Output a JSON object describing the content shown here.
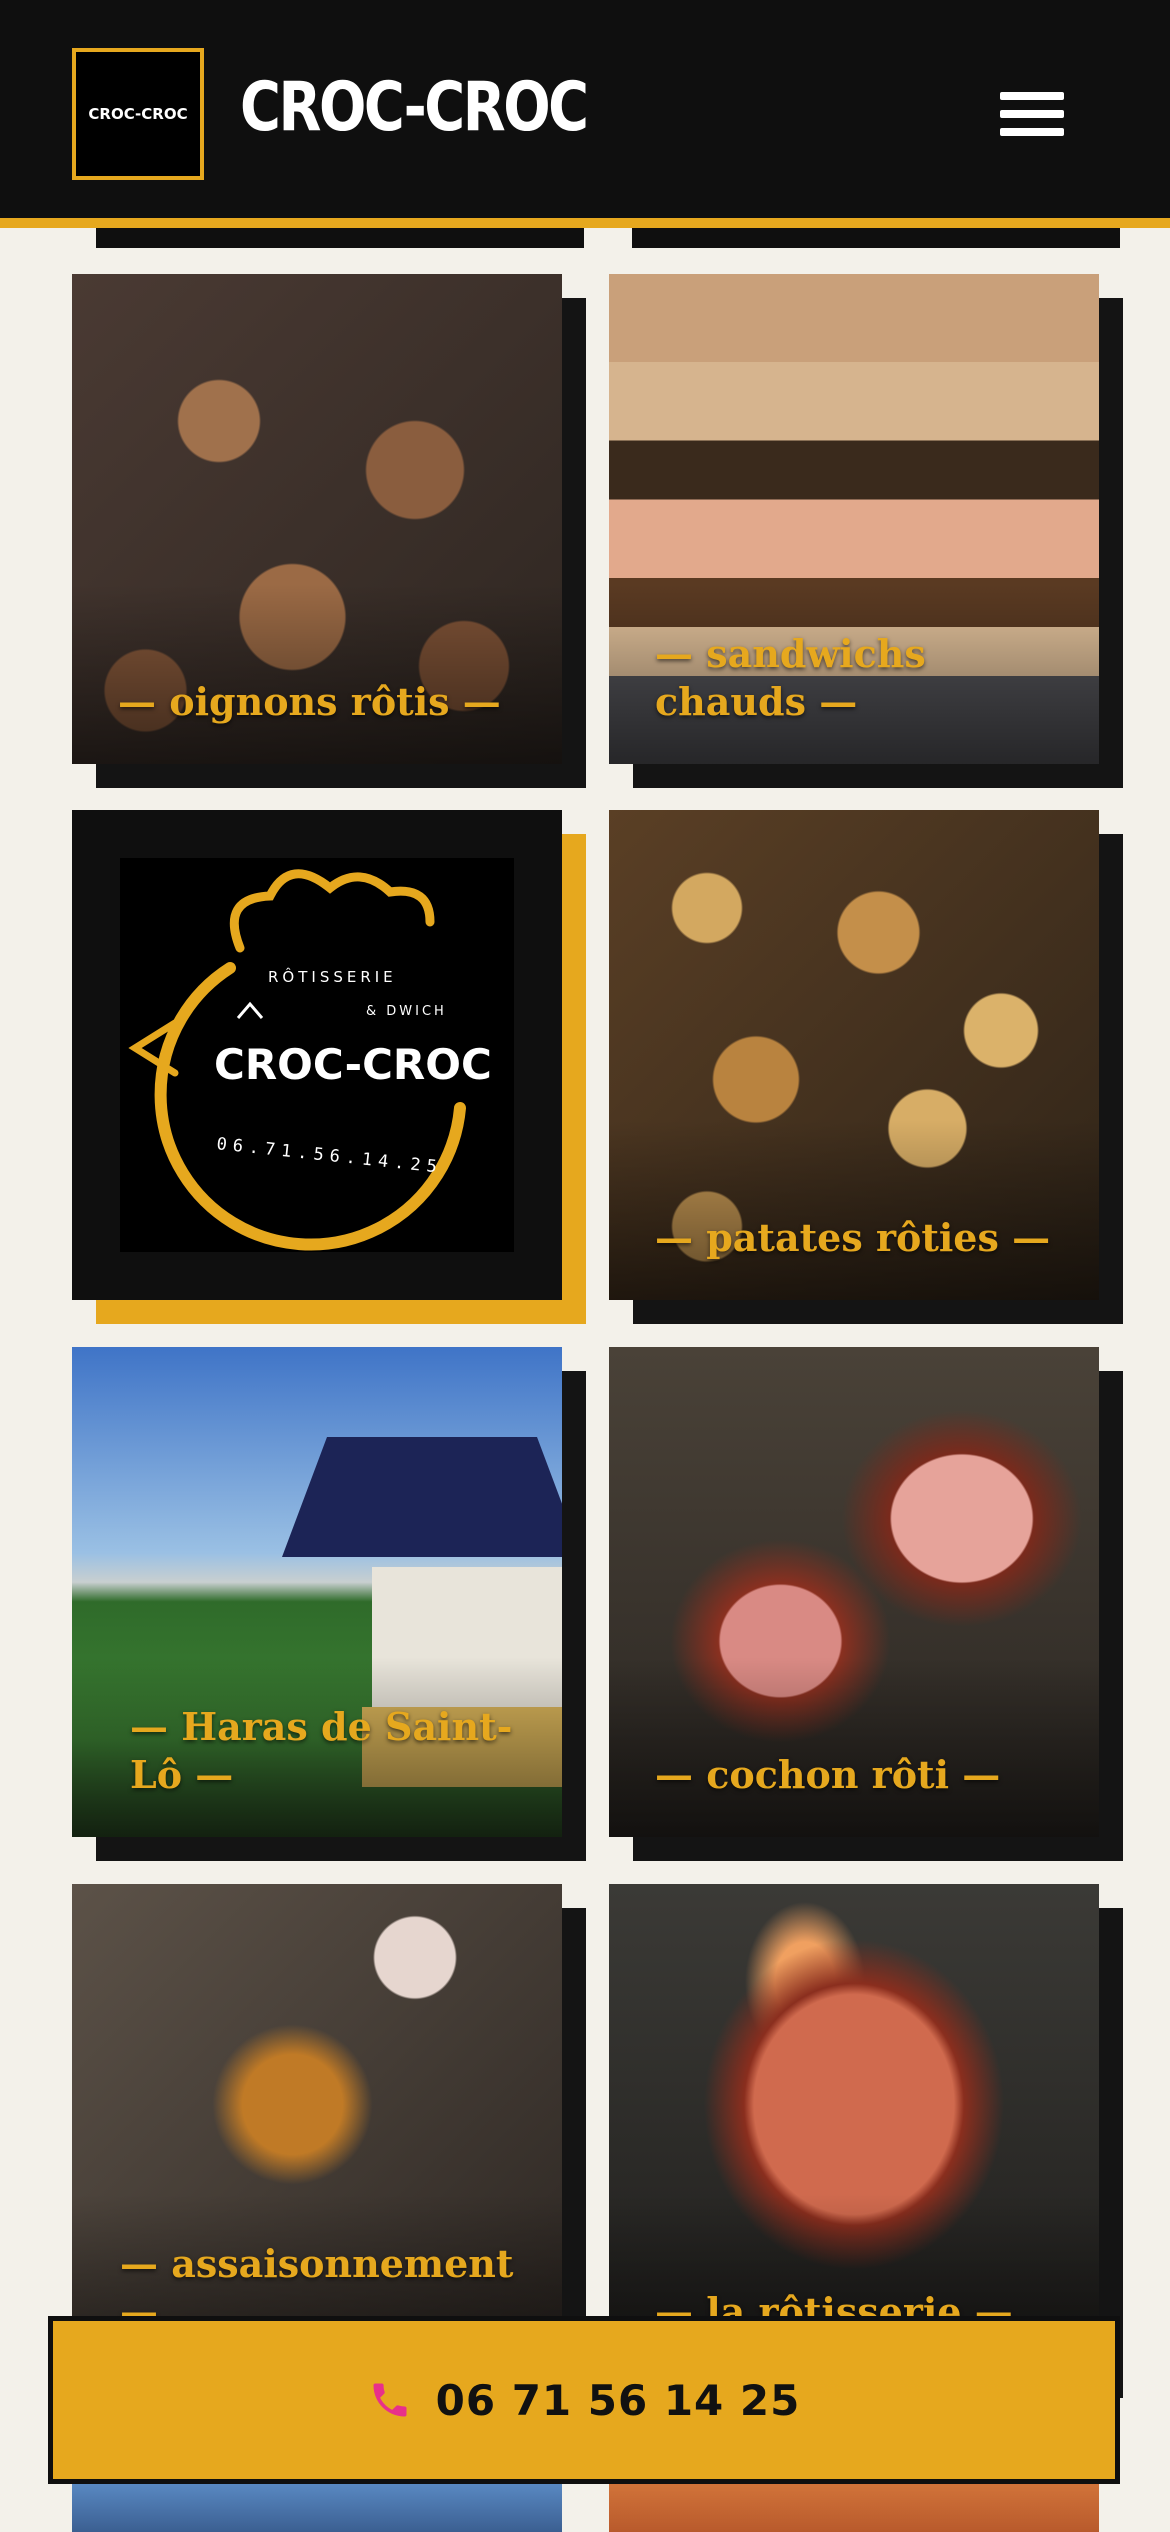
{
  "header": {
    "brand": "CROC-CROC",
    "logo_text": "CROC-CROC",
    "menu_icon": "hamburger-menu-icon"
  },
  "cards": [
    {
      "caption": "— oignons rôtis —"
    },
    {
      "caption": "— sandwichs chauds —"
    },
    {
      "caption": ""
    },
    {
      "caption": "— patates rôties —"
    },
    {
      "caption": "— Haras de Saint-Lô —"
    },
    {
      "caption": "— cochon rôti —"
    },
    {
      "caption": "— assaisonnement —"
    },
    {
      "caption": "— la rôtisserie —"
    }
  ],
  "logo_card": {
    "top": "RÔTISSERIE",
    "sub": "& DWICH",
    "name": "CROC-CROC",
    "phone": "06.71.56.14.25"
  },
  "cta": {
    "icon": "phone-icon",
    "phone": "06 71 56 14 25"
  },
  "colors": {
    "accent": "#e6a81e",
    "dark": "#0f0f0f",
    "background": "#f3f1ea"
  }
}
